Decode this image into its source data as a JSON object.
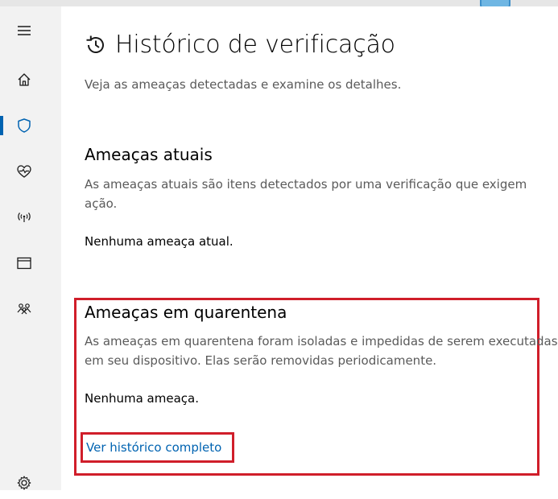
{
  "sidebar": {
    "items": [
      {
        "icon": "hamburger-menu-icon"
      },
      {
        "icon": "home-icon"
      },
      {
        "icon": "shield-icon",
        "active": true
      },
      {
        "icon": "heart-health-icon"
      },
      {
        "icon": "wireless-network-icon"
      },
      {
        "icon": "browser-window-icon"
      },
      {
        "icon": "family-icon"
      },
      {
        "icon": "settings-gear-icon"
      }
    ]
  },
  "colors": {
    "accent": "#0063b1",
    "highlight": "#d01e2a",
    "sidebar_bg": "#f2f2f2",
    "secondary_text": "#5a5a5a"
  },
  "page": {
    "title": "Histórico de verificação",
    "title_icon": "history-clock-icon",
    "subtitle": "Veja as ameaças detectadas e examine os detalhes."
  },
  "current_threats": {
    "title": "Ameaças atuais",
    "description": "As ameaças atuais são itens detectados por uma verificação que exigem ação.",
    "status": "Nenhuma ameaça atual."
  },
  "quarantine": {
    "title": "Ameaças em quarentena",
    "description": "As ameaças em quarentena foram isoladas e impedidas de serem executadas em seu dispositivo. Elas serão removidas periodicamente.",
    "status": "Nenhuma ameaça.",
    "link_label": "Ver histórico completo"
  }
}
